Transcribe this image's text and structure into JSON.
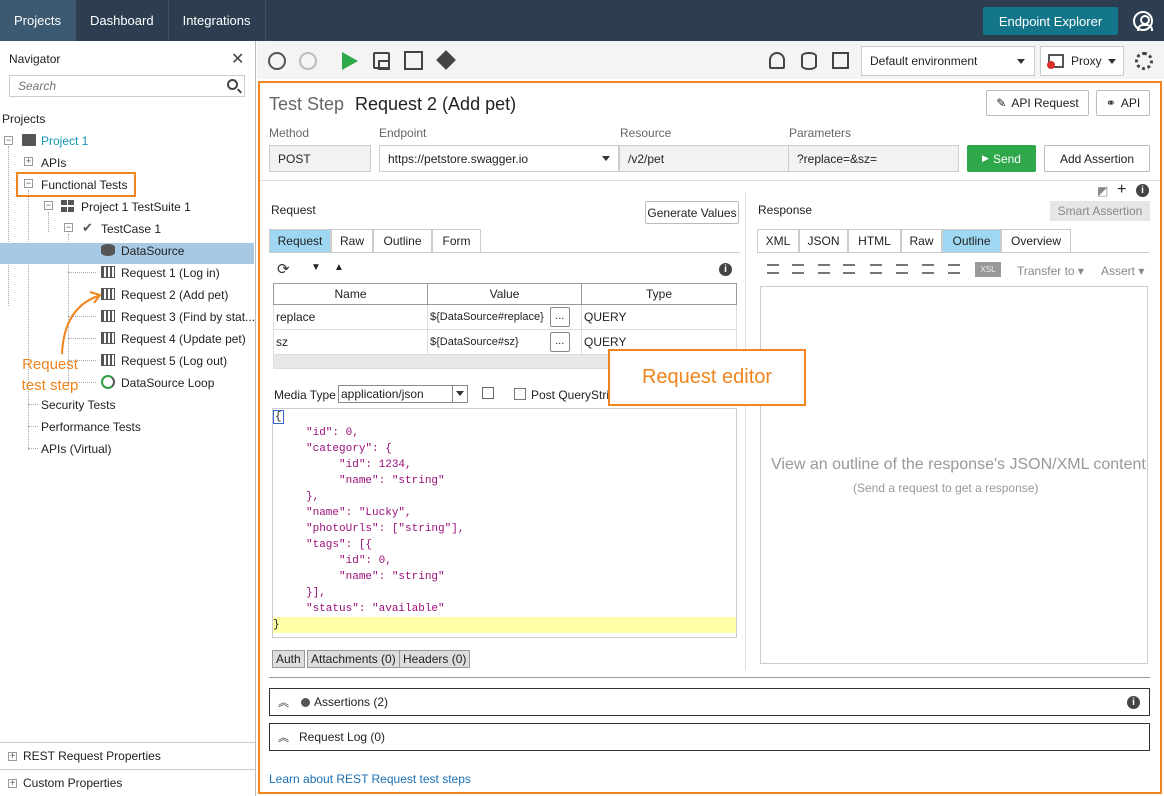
{
  "topbar": {
    "tabs": [
      "Projects",
      "Dashboard",
      "Integrations"
    ],
    "endpoint_explorer": "Endpoint Explorer"
  },
  "navigator": {
    "title": "Navigator",
    "search_placeholder": "Search",
    "projects_label": "Projects",
    "tree": {
      "project": "Project 1",
      "apis": "APIs",
      "functional_tests": "Functional Tests",
      "suite": "Project 1 TestSuite 1",
      "testcase": "TestCase 1",
      "steps": [
        "DataSource",
        "Request 1 (Log in)",
        "Request 2 (Add pet)",
        "Request 3 (Find by stat...",
        "Request 4 (Update pet)",
        "Request 5 (Log out)",
        "DataSource Loop"
      ],
      "security": "Security Tests",
      "performance": "Performance Tests",
      "virtual": "APIs (Virtual)"
    },
    "footer": [
      "REST Request Properties",
      "Custom Properties"
    ]
  },
  "toolbar": {
    "environment": "Default environment",
    "proxy": "Proxy"
  },
  "step": {
    "type_label": "Test Step",
    "name": "Request 2 (Add pet)",
    "api_request_btn": "API Request",
    "api_btn": "API",
    "method_label": "Method",
    "method": "POST",
    "endpoint_label": "Endpoint",
    "endpoint": "https://petstore.swagger.io",
    "resource_label": "Resource",
    "resource": "/v2/pet",
    "params_label": "Parameters",
    "params": "?replace=&sz=",
    "send": "Send",
    "add_assertion": "Add Assertion"
  },
  "request": {
    "title": "Request",
    "generate_values": "Generate Values",
    "tabs": [
      "Request",
      "Raw",
      "Outline",
      "Form"
    ],
    "columns": [
      "Name",
      "Value",
      "Type"
    ],
    "rows": [
      {
        "name": "replace",
        "value": "${DataSource#replace}",
        "type": "QUERY"
      },
      {
        "name": "sz",
        "value": "${DataSource#sz}",
        "type": "QUERY"
      }
    ],
    "media_type_label": "Media Type",
    "media_type": "application/json",
    "post_query": "Post QueryStri",
    "body_lines": [
      "{",
      "     \"id\": 0,",
      "     \"category\": {",
      "          \"id\": 1234,",
      "          \"name\": \"string\"",
      "     },",
      "     \"name\": \"Lucky\",",
      "     \"photoUrls\": [\"string\"],",
      "     \"tags\": [{",
      "          \"id\": 0,",
      "          \"name\": \"string\"",
      "     }],",
      "     \"status\": \"available\"",
      "}"
    ],
    "bottom_tabs": [
      "Auth",
      "Attachments (0)",
      "Headers (0)"
    ]
  },
  "response": {
    "title": "Response",
    "smart_assertion": "Smart Assertion",
    "tabs": [
      "XML",
      "JSON",
      "HTML",
      "Raw",
      "Outline",
      "Overview"
    ],
    "transfer_to": "Transfer to",
    "assert": "Assert",
    "xsl": "XSL",
    "placeholder_main": "View an outline of the response's JSON/XML content",
    "placeholder_sub": "(Send a request to get a response)"
  },
  "panels": {
    "assertions": "Assertions (2)",
    "request_log": "Request Log (0)"
  },
  "link": "Learn about REST Request test steps",
  "annotations": {
    "request_editor": "Request editor",
    "request_test_step_1": "Request",
    "request_test_step_2": "test step"
  }
}
